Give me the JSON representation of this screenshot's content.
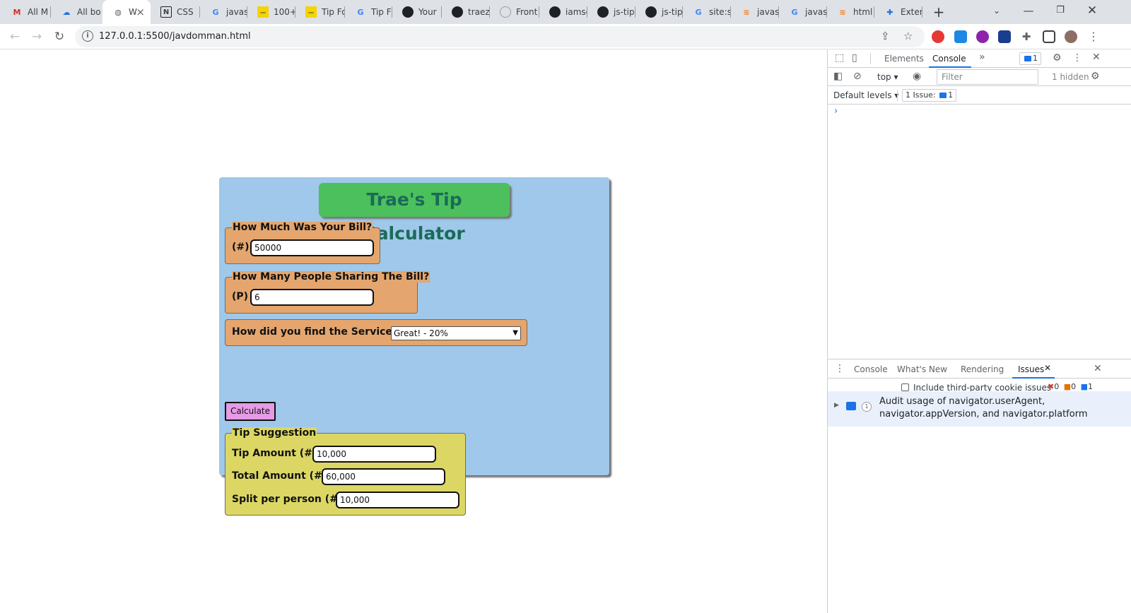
{
  "browser": {
    "tabs": [
      {
        "label": "All M",
        "icon": "gmail-icon"
      },
      {
        "label": "All bo",
        "icon": "cloud-icon"
      },
      {
        "label": "W",
        "icon": "globe-icon",
        "active": true
      },
      {
        "label": "CSS",
        "icon": "notion-icon"
      },
      {
        "label": "javas",
        "icon": "google-icon"
      },
      {
        "label": "100+",
        "icon": "yellow-site-icon"
      },
      {
        "label": "Tip Fo",
        "icon": "yellow-site-icon"
      },
      {
        "label": "Tip Fo",
        "icon": "google-icon"
      },
      {
        "label": "Your",
        "icon": "github-icon"
      },
      {
        "label": "traez",
        "icon": "github-icon"
      },
      {
        "label": "Front",
        "icon": "frontend-icon"
      },
      {
        "label": "iamsc",
        "icon": "github-icon"
      },
      {
        "label": "js-tip",
        "icon": "github-icon"
      },
      {
        "label": "js-tip",
        "icon": "github-icon"
      },
      {
        "label": "site:st",
        "icon": "google-icon"
      },
      {
        "label": "javas",
        "icon": "stackoverflow-icon"
      },
      {
        "label": "javas",
        "icon": "google-icon"
      },
      {
        "label": "html",
        "icon": "stackoverflow-icon"
      },
      {
        "label": "Exten",
        "icon": "puzzle-icon"
      }
    ],
    "url": "127.0.0.1:5500/javdomman.html"
  },
  "app": {
    "title": "Trae's Tip Calculator",
    "bill": {
      "legend": "How Much Was Your Bill?",
      "prefix": "(#)",
      "value": "50000"
    },
    "people": {
      "legend": "How Many People Sharing The Bill?",
      "prefix": "(P)",
      "value": "6"
    },
    "service": {
      "label": "How did you find the Service?",
      "selected": "Great! - 20%"
    },
    "calculate_label": "Calculate",
    "result": {
      "legend": "Tip Suggestion",
      "tip_label": "Tip Amount (#)",
      "tip_value": "10,000",
      "total_label": "Total Amount (#)",
      "total_value": "60,000",
      "split_label": "Split per person (#)",
      "split_value": "10,000"
    }
  },
  "devtools": {
    "tabs": {
      "elements": "Elements",
      "console": "Console"
    },
    "issue_badge_count": "1",
    "context": "top",
    "filter_placeholder": "Filter",
    "hidden": "1 hidden",
    "default_levels": "Default levels",
    "issues_badge": "1 Issue:",
    "issues_badge_count": "1",
    "prompt": "›",
    "drawer_tabs": {
      "console": "Console",
      "whats_new": "What's New",
      "rendering": "Rendering",
      "issues": "Issues"
    },
    "third_party_label": "Include third-party cookie issues",
    "counts": {
      "errors": "0",
      "warnings": "0",
      "info": "1"
    },
    "issue": {
      "count": "1",
      "text_line1": "Audit usage of navigator.userAgent,",
      "text_line2": "navigator.appVersion, and navigator.platform"
    }
  }
}
